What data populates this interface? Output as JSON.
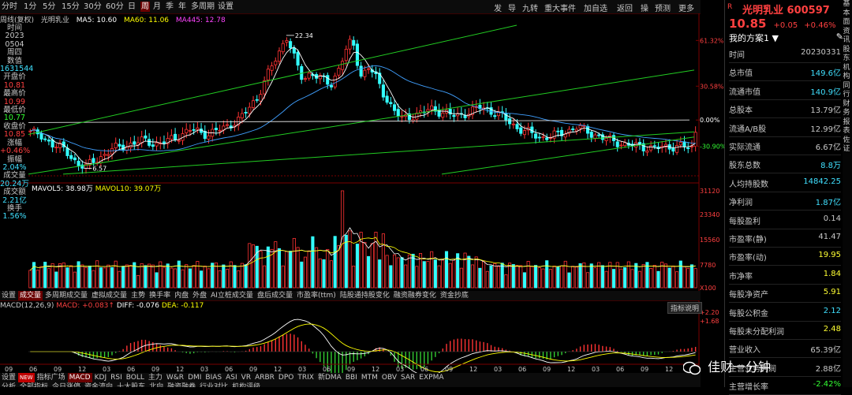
{
  "toolbar": {
    "periods": [
      "分时",
      "1分",
      "5分",
      "15分",
      "30分",
      "60分",
      "日",
      "周",
      "月",
      "季",
      "年",
      "多周期",
      "设置"
    ],
    "selected_period": "周",
    "right_items": [
      "发",
      "导",
      "九转",
      "重大事件",
      "加自选",
      "返回",
      "操",
      "预测",
      "更多"
    ]
  },
  "info_line": {
    "mode": "周线(复权)",
    "stock": "光明乳业",
    "ma5": "MA5: 10.60",
    "ma60": "MA60: 11.06",
    "ma445": "MA445: 12.78"
  },
  "left_info": [
    {
      "label": "时间",
      "value": "2023",
      "value2": "0504",
      "cls": "lbl"
    },
    {
      "label": "周四",
      "value": "数值",
      "cls": "lbl"
    },
    {
      "label": "",
      "value": "1631544",
      "cls": "vcyan"
    },
    {
      "label": "开盘价",
      "value": "10.81",
      "cls": "vred"
    },
    {
      "label": "最高价",
      "value": "10.99",
      "cls": "vred"
    },
    {
      "label": "最低价",
      "value": "10.77",
      "cls": "vgreen"
    },
    {
      "label": "收盘价",
      "value": "10.85",
      "cls": "vred"
    },
    {
      "label": "涨幅",
      "value": "+0.46%",
      "cls": "vred"
    },
    {
      "label": "振幅",
      "value": "2.04%",
      "cls": "vcyan"
    },
    {
      "label": "成交量",
      "value": "20.24万",
      "cls": "vcyan"
    },
    {
      "label": "成交额",
      "value": "2.21亿",
      "cls": "vcyan"
    },
    {
      "label": "换手",
      "value": "1.56%",
      "cls": "vcyan"
    }
  ],
  "price_annotations": {
    "high": "22.34",
    "low": "6.57",
    "pct_labels": [
      "61.32%",
      "30.58%",
      "0.00%",
      "-30.90%"
    ]
  },
  "volume": {
    "header": "MAVOL5: 38.98万",
    "header2": "MAVOL10: 39.07万",
    "ticks": [
      "31120",
      "23340",
      "15560",
      "7780",
      "X100"
    ]
  },
  "indicator_tabs": [
    "设置",
    "成交量",
    "多周期成交量",
    "虚拟成交量",
    "主势",
    "换手率",
    "内盘",
    "外盘",
    "AI立桩成交量",
    "盘后成交量",
    "市盈率(ttm)",
    "陆股通持股变化",
    "融资融券变化",
    "资金抄底"
  ],
  "selected_indicator_tab": "成交量",
  "macd": {
    "header": "MACD(12,26,9)",
    "macd_val": "MACD: +0.083↑",
    "diff": "DIFF: -0.076",
    "dea": "DEA: -0.117",
    "explain": "指标说明",
    "ticks": [
      "+2.20",
      "+1.68"
    ]
  },
  "x_axis_labels": [
    "09",
    "06",
    "09",
    "12",
    "03",
    "06",
    "09",
    "12",
    "03",
    "06",
    "09",
    "12",
    "03",
    "06",
    "09",
    "12",
    "03",
    "06",
    "09",
    "12",
    "03",
    "06",
    "09",
    "12",
    "03",
    "06",
    "09",
    "12",
    "03"
  ],
  "bottom_tabs": [
    "设置",
    "NEW",
    "指标广场",
    "MACD",
    "KDJ",
    "RSI",
    "BOLL",
    "主力",
    "W&R",
    "DMI",
    "BIAS",
    "ASI",
    "VR",
    "ARBR",
    "DPO",
    "TRIX",
    "新DMA",
    "BBI",
    "MTM",
    "OBV",
    "SAR",
    "EXPMA"
  ],
  "selected_bottom_tab": "MACD",
  "bottom_tabs2": [
    "分析",
    "全部指标",
    "今日涨停",
    "资金流向",
    "十大股东",
    "北向",
    "融资融券",
    "行业对比",
    "机构评级"
  ],
  "right_panel": {
    "stock_name": "光明乳业",
    "stock_code": "600597",
    "price": "10.85",
    "change": "+0.05",
    "change_pct": "+0.46%",
    "plan": "我的方案1",
    "rows": [
      {
        "k": "时间",
        "v": "20230331",
        "c": "#c8c8c8"
      },
      {
        "k": "总市值",
        "v": "149.6亿",
        "c": "#40e0ff"
      },
      {
        "k": "流通市值",
        "v": "140.9亿",
        "c": "#40e0ff"
      },
      {
        "k": "总股本",
        "v": "13.79亿",
        "c": "#c8c8c8"
      },
      {
        "k": "流通A/B股",
        "v": "12.99亿",
        "c": "#c8c8c8"
      },
      {
        "k": "实际流通",
        "v": "6.67亿",
        "c": "#c8c8c8"
      },
      {
        "k": "股东总数",
        "v": "8.8万",
        "c": "#40e0ff"
      },
      {
        "k": "人均持股数",
        "v": "14842.25",
        "c": "#40e0ff"
      },
      {
        "k": "净利润",
        "v": "1.87亿",
        "c": "#40e0ff"
      },
      {
        "k": "每股盈利",
        "v": "0.14",
        "c": "#c8c8c8"
      },
      {
        "k": "市盈率(静)",
        "v": "41.47",
        "c": "#c8c8c8"
      },
      {
        "k": "市盈率(动)",
        "v": "19.95",
        "c": "#ffff33"
      },
      {
        "k": "市净率",
        "v": "1.84",
        "c": "#ffff33"
      },
      {
        "k": "每股净资产",
        "v": "5.91",
        "c": "#ffff33"
      },
      {
        "k": "每股公积金",
        "v": "2.12",
        "c": "#40e0ff"
      },
      {
        "k": "每股未分配利润",
        "v": "2.48",
        "c": "#ffff33"
      },
      {
        "k": "营业收入",
        "v": "65.39亿",
        "c": "#c8c8c8"
      },
      {
        "k": "主营业务利润",
        "v": "2.88亿",
        "c": "#c8c8c8"
      },
      {
        "k": "主营增长率",
        "v": "-2.42%",
        "c": "#33ff33"
      }
    ],
    "strip": "基本面资讯股东机构同行财务报表佐证"
  },
  "watermark": "佳财一分钟",
  "colors": {
    "up": "#ff3333",
    "down": "#33ffff",
    "ma5": "#ffffff",
    "ma60": "#ffff00",
    "ma445": "#ff44ff",
    "channel": "#22cc22"
  }
}
